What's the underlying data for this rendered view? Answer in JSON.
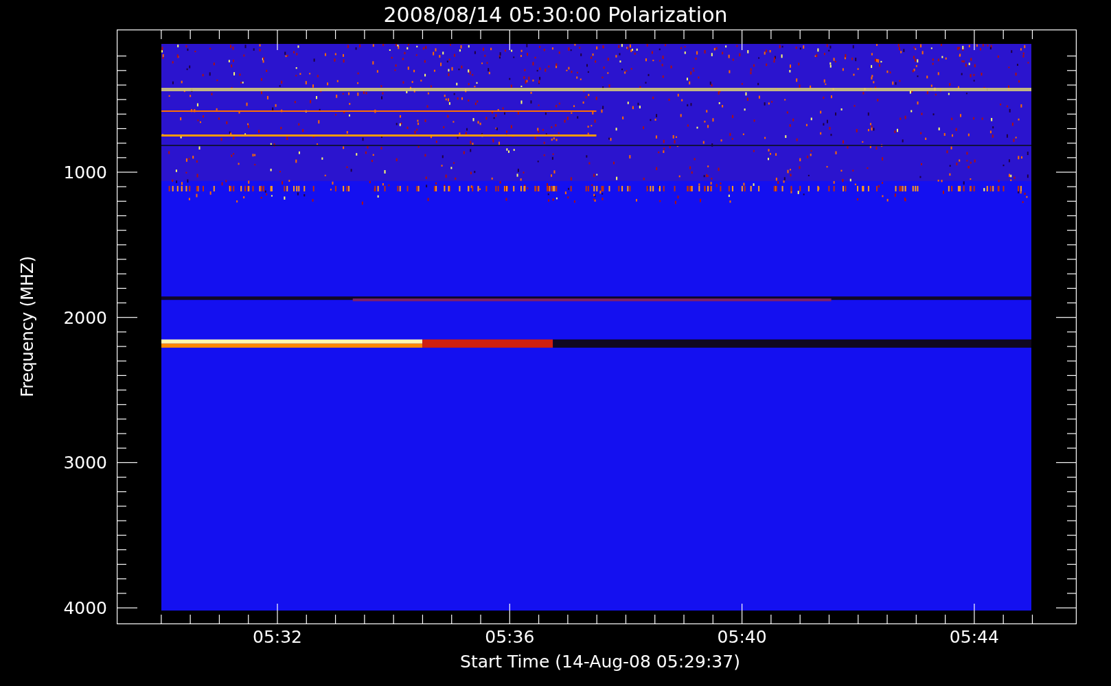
{
  "title": "2008/08/14 05:30:00 Polarization",
  "y_axis": {
    "label": "Frequency (MHZ)",
    "ticks": [
      "1000",
      "2000",
      "3000",
      "4000"
    ]
  },
  "x_axis": {
    "label": "Start Time (14-Aug-08 05:29:37)",
    "ticks": [
      "05:32",
      "05:36",
      "05:40",
      "05:44"
    ]
  }
}
